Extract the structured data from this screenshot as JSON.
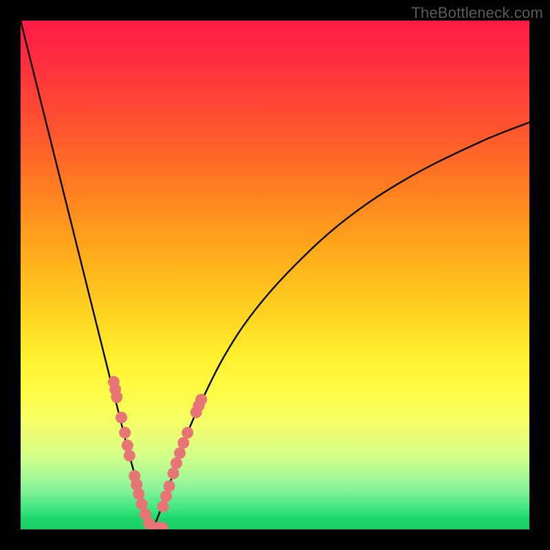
{
  "watermark": "TheBottleneck.com",
  "colors": {
    "background": "#000000",
    "curve": "#000000",
    "dot": "#e77576",
    "gradient_top": "#ff1a47",
    "gradient_bottom": "#17d066"
  },
  "chart_data": {
    "type": "line",
    "title": "",
    "xlabel": "",
    "ylabel": "",
    "xlim": [
      0,
      100
    ],
    "ylim": [
      0,
      100
    ],
    "series": [
      {
        "name": "left-branch",
        "x": [
          0,
          3,
          6,
          9,
          12,
          14,
          16,
          18,
          19.5,
          21,
          22.5,
          24,
          25,
          26
        ],
        "y": [
          100,
          88,
          76,
          64,
          52,
          44,
          36,
          28,
          22,
          16,
          10.5,
          5.5,
          2,
          0
        ]
      },
      {
        "name": "right-branch",
        "x": [
          26,
          27,
          28.5,
          30,
          32,
          35,
          40,
          46,
          54,
          64,
          76,
          90,
          100
        ],
        "y": [
          0,
          2.5,
          6.5,
          11,
          17,
          24,
          34,
          43,
          52,
          61,
          69,
          76,
          80
        ]
      }
    ],
    "annotations": {
      "name": "salmon-dots",
      "points": [
        {
          "x": 18.3,
          "y": 29.0
        },
        {
          "x": 18.6,
          "y": 27.5
        },
        {
          "x": 18.9,
          "y": 26.0
        },
        {
          "x": 19.8,
          "y": 22.0
        },
        {
          "x": 20.5,
          "y": 19.0
        },
        {
          "x": 21.0,
          "y": 16.5
        },
        {
          "x": 21.4,
          "y": 14.5
        },
        {
          "x": 22.4,
          "y": 10.5
        },
        {
          "x": 22.8,
          "y": 8.8
        },
        {
          "x": 23.2,
          "y": 7.0
        },
        {
          "x": 23.8,
          "y": 5.0
        },
        {
          "x": 24.5,
          "y": 3.0
        },
        {
          "x": 25.2,
          "y": 1.2
        },
        {
          "x": 25.8,
          "y": 0.4
        },
        {
          "x": 26.5,
          "y": 0.3
        },
        {
          "x": 27.2,
          "y": 0.3
        },
        {
          "x": 27.9,
          "y": 0.3
        },
        {
          "x": 28.0,
          "y": 4.5
        },
        {
          "x": 28.6,
          "y": 6.5
        },
        {
          "x": 29.2,
          "y": 8.5
        },
        {
          "x": 30.0,
          "y": 11.0
        },
        {
          "x": 30.6,
          "y": 13.0
        },
        {
          "x": 31.3,
          "y": 15.0
        },
        {
          "x": 32.0,
          "y": 17.0
        },
        {
          "x": 32.8,
          "y": 19.0
        },
        {
          "x": 34.5,
          "y": 23.0
        },
        {
          "x": 35.0,
          "y": 24.3
        },
        {
          "x": 35.5,
          "y": 25.5
        }
      ]
    }
  }
}
